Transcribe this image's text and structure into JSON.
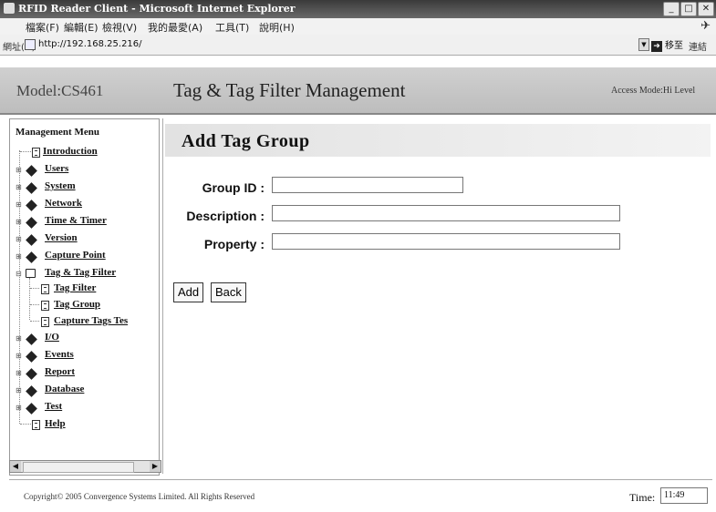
{
  "browser": {
    "window_title": "RFID Reader Client - Microsoft Internet Explorer",
    "menu": [
      "檔案(F)",
      "編輯(E)",
      "檢視(V)",
      "我的最愛(A)",
      "工具(T)",
      "說明(H)"
    ],
    "address_label": "網址(D)",
    "url": "http://192.168.25.216/",
    "go_label": "移至",
    "links_label": "連結"
  },
  "header": {
    "model": "Model:CS461",
    "title": "Tag & Tag Filter Management",
    "access_mode": "Access Mode:Hi Level"
  },
  "nav": {
    "title": "Management Menu",
    "items": [
      {
        "label": "Introduction"
      },
      {
        "label": "Users"
      },
      {
        "label": "System"
      },
      {
        "label": "Network"
      },
      {
        "label": "Time & Timer"
      },
      {
        "label": "Version"
      },
      {
        "label": "Capture Point"
      },
      {
        "label": "Tag & Tag Filter"
      },
      {
        "label": "Tag Filter"
      },
      {
        "label": "Tag Group"
      },
      {
        "label": "Capture Tags Tes"
      },
      {
        "label": "I/O"
      },
      {
        "label": "Events"
      },
      {
        "label": "Report"
      },
      {
        "label": "Database"
      },
      {
        "label": "Test"
      },
      {
        "label": "Help"
      }
    ]
  },
  "form": {
    "heading": "Add Tag Group",
    "group_id_label": "Group ID :",
    "group_id_value": "",
    "description_label": "Description :",
    "description_value": "",
    "property_label": "Property :",
    "property_value": "",
    "add_label": "Add",
    "back_label": "Back"
  },
  "footer": {
    "copyright": "Copyright© 2005 Convergence Systems Limited. All Rights Reserved",
    "time_label": "Time:",
    "time_value": "11:49"
  }
}
